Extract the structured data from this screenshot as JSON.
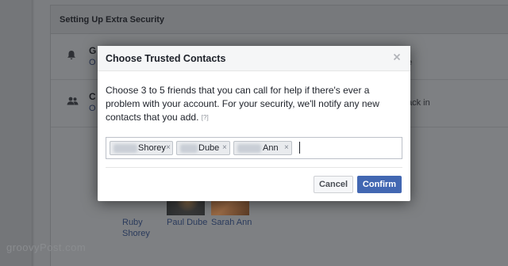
{
  "background": {
    "section_title": "Setting Up Extra Security",
    "rows": [
      {
        "icon": "bell-icon",
        "letter": "G",
        "sub": "O",
        "right_fragment": "e"
      },
      {
        "icon": "people-icon",
        "letter": "C",
        "sub": "O",
        "right_fragment": "ack in"
      }
    ],
    "friends": [
      {
        "name": "Ruby Shorey"
      },
      {
        "name": "Paul Dube"
      },
      {
        "name": "Sarah Ann"
      }
    ],
    "watermark": "groovyPost.com"
  },
  "dialog": {
    "title": "Choose Trusted Contacts",
    "close_icon": "close-icon",
    "description": "Choose 3 to 5 friends that you can call for help if there's ever a problem with your account. For your security, we'll notify any new contacts that you add.",
    "help_link": "[?]",
    "tokens": [
      {
        "label": "Shorey",
        "remove": "×"
      },
      {
        "label": "Dube",
        "remove": "×"
      },
      {
        "label": "Ann",
        "remove": "×"
      }
    ],
    "buttons": {
      "cancel": "Cancel",
      "confirm": "Confirm"
    }
  },
  "colors": {
    "accent": "#4267b2",
    "overlay": "#7b7d80",
    "dialog_header": "#f5f6f7"
  }
}
